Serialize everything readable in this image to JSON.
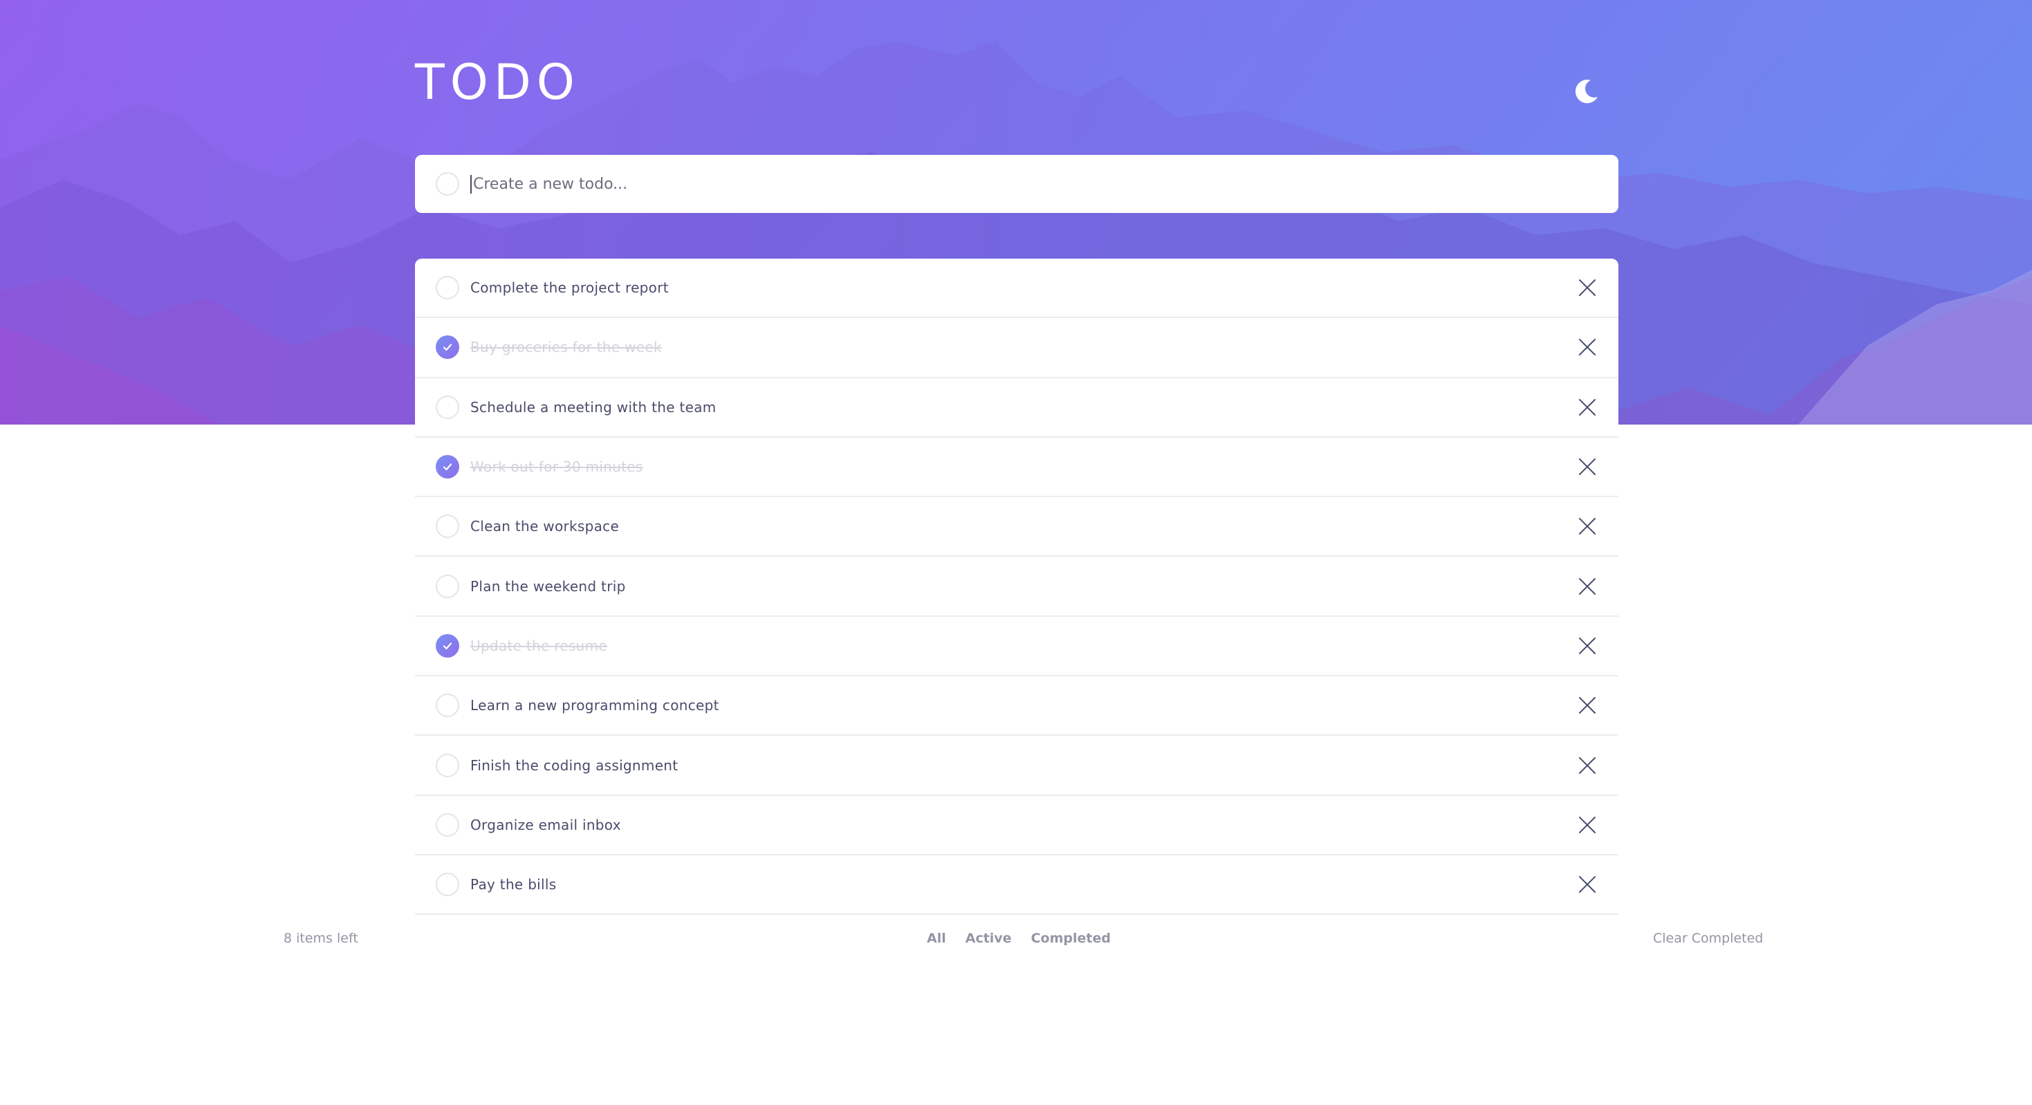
{
  "app": {
    "title": "TODO",
    "theme_toggle_icon": "moon-icon"
  },
  "new_todo": {
    "placeholder": "Create a new todo...",
    "value": ""
  },
  "todos": [
    {
      "label": "Complete the project report",
      "completed": false
    },
    {
      "label": "Buy groceries for the week",
      "completed": true
    },
    {
      "label": "Schedule a meeting with the team",
      "completed": false
    },
    {
      "label": "Work out for 30 minutes",
      "completed": true
    },
    {
      "label": "Clean the workspace",
      "completed": false
    },
    {
      "label": "Plan the weekend trip",
      "completed": false
    },
    {
      "label": "Update the resume",
      "completed": true
    },
    {
      "label": "Learn a new programming concept",
      "completed": false
    },
    {
      "label": "Finish the coding assignment",
      "completed": false
    },
    {
      "label": "Organize email inbox",
      "completed": false
    },
    {
      "label": "Pay the bills",
      "completed": false
    }
  ],
  "footer": {
    "items_left": "8 items left",
    "filters": [
      "All",
      "Active",
      "Completed"
    ],
    "clear_label": "Clear Completed"
  },
  "colors": {
    "hero_start": "#8a6cf2",
    "hero_end": "#6c8cf0",
    "check_gradient_start": "#7a8ef5",
    "check_gradient_end": "#8f6fe8",
    "text": "#494c6b",
    "completed_text": "#d2d3db",
    "muted": "#9495a5"
  }
}
